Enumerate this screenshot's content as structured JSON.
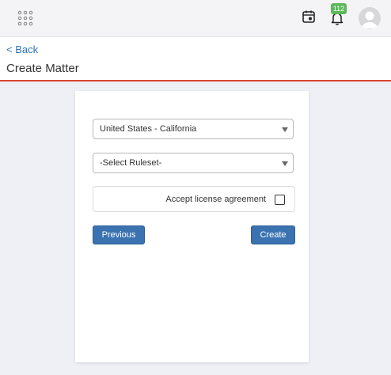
{
  "topbar": {
    "icons": [
      "apps-grid-icon",
      "calendar-icon",
      "bell-icon",
      "avatar-icon"
    ],
    "notification_count": "112"
  },
  "header": {
    "back_label": "< Back",
    "title": "Create Matter"
  },
  "form": {
    "jurisdiction_value": "United States - California",
    "ruleset_value": "-Select Ruleset-",
    "license_label": "Accept license agreement",
    "license_checked": false,
    "previous_label": "Previous",
    "create_label": "Create"
  },
  "colors": {
    "accent": "#d9432f",
    "link": "#2d73b8",
    "button": "#3b73b1",
    "badge": "#5cb85c"
  }
}
